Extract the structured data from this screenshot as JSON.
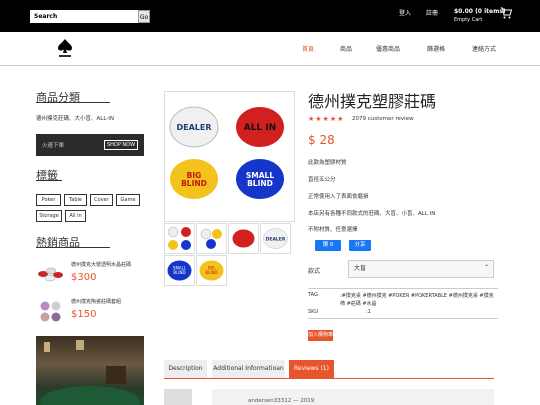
{
  "header": {
    "search_placeholder": "Search",
    "search_go": "Go",
    "login": "登入",
    "register": "註冊",
    "cart_amount": "$0.00 (0 items)",
    "cart_status": "Empty Cart"
  },
  "nav": {
    "items": [
      "首頁",
      "商品",
      "優惠商品",
      "篩選格",
      "連絡方式"
    ]
  },
  "sidebar": {
    "categories_title": "商品分類",
    "categories_text": "德州撲克莊碼、大小盲、ALL-IN",
    "banner_text": "火速下單",
    "banner_button": "SHOP NOW",
    "tags_title": "標籤",
    "tags": [
      "Poker",
      "Table",
      "Cover",
      "Game",
      "Storage",
      "All in"
    ],
    "hot_title": "熱銷商品",
    "hot_items": [
      {
        "name": "德州撲克大號透明水晶莊碼",
        "price": "$300"
      },
      {
        "name": "德州撲克陶瓷莊碼套組",
        "price": "$150"
      }
    ]
  },
  "product": {
    "title": "德州撲克塑膠莊碼",
    "rating_stars": "★★★★★",
    "reviews": "2079 customer review",
    "price": "$ 28",
    "desc": [
      "此款為塑膠材質",
      "直徑五公分",
      "正常使用入了表面會磨損",
      "本店另有各種不同款式的莊碼、大盲、小盲、ALL IN",
      "不附材質、任意選擇"
    ],
    "share_like": "讚 0",
    "share_share": "分享",
    "option_label": "款式",
    "option_value": "大盲",
    "tag_label": "TAG",
    "tag_value": ":#撲克桌 #德州撲克 #POKER #POKERTABLE #德州撲克桌 #撲克椅 #莊碼 #水晶",
    "sku_label": "SKU",
    "sku_value": ":1",
    "add_to_cart": "加入購物車",
    "chip_labels": [
      "DEALER",
      "ALL IN",
      "BIG BLIND",
      "SMALL BLIND"
    ]
  },
  "tabs": [
    "Description",
    "Additional Informatioan",
    "Reviews (1)"
  ],
  "review": {
    "author": "andersen33312 — 2019"
  },
  "colors": {
    "accent": "#e8542b",
    "topbar": "#000000",
    "facebook": "#1877f2"
  }
}
